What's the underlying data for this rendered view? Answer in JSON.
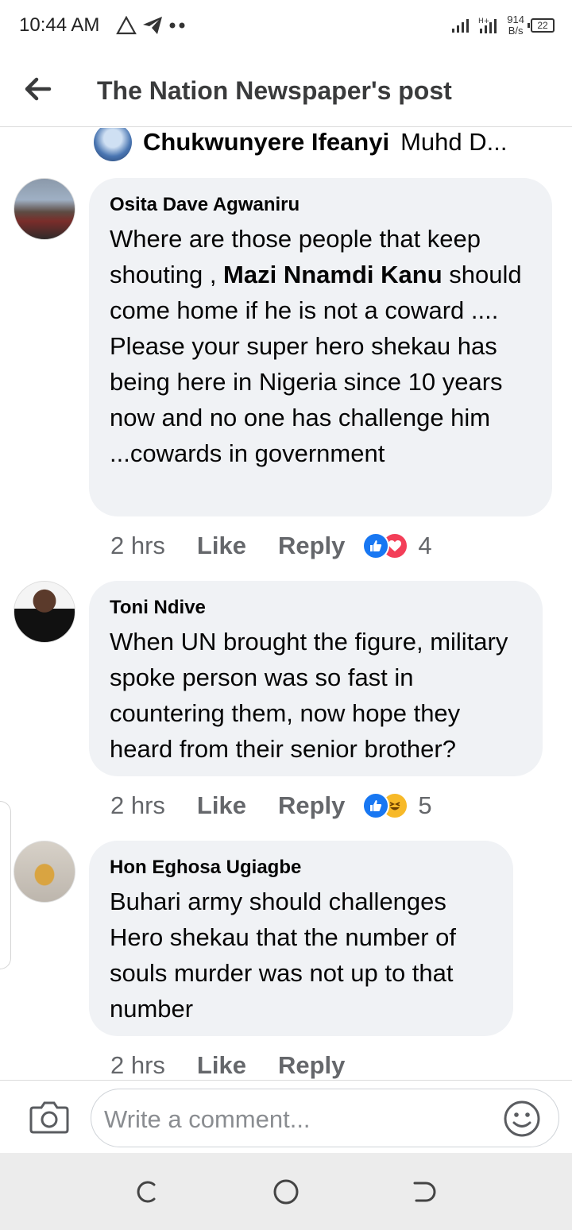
{
  "status_bar": {
    "time": "10:44 AM",
    "net_speed_top": "914",
    "net_speed_bottom": "B/s",
    "battery": "22"
  },
  "header": {
    "title": "The Nation Newspaper's post"
  },
  "reply_preview": {
    "name": "Chukwunyere Ifeanyi",
    "text": "Muhd D..."
  },
  "comments": [
    {
      "author": "Osita Dave Agwaniru",
      "text_before": "Where are those people that keep shouting , ",
      "text_bold": "Mazi Nnamdi Kanu",
      "text_after": " should come home if he is not a coward .... Please your super hero shekau has being  here in Nigeria since 10 years now and no one has challenge him ...cowards in government",
      "time": "2 hrs",
      "like_label": "Like",
      "reply_label": "Reply",
      "reactions": [
        "like",
        "love"
      ],
      "reaction_count": "4"
    },
    {
      "author": "Toni Ndive",
      "text": "When UN brought the figure, military spoke person was so fast in countering them, now hope they heard from their senior brother?",
      "time": "2 hrs",
      "like_label": "Like",
      "reply_label": "Reply",
      "reactions": [
        "like",
        "haha"
      ],
      "reaction_count": "5"
    },
    {
      "author": "Hon Eghosa Ugiagbe",
      "text": "Buhari army should challenges Hero shekau that the number of souls murder was not up to that number",
      "time": "2 hrs",
      "like_label": "Like",
      "reply_label": "Reply"
    }
  ],
  "composer": {
    "placeholder": "Write a comment..."
  },
  "colors": {
    "bubble": "#f0f2f5",
    "meta_text": "#65676b",
    "like_blue": "#1877f2",
    "love_red": "#f33e58",
    "haha_yellow": "#f7b928"
  }
}
